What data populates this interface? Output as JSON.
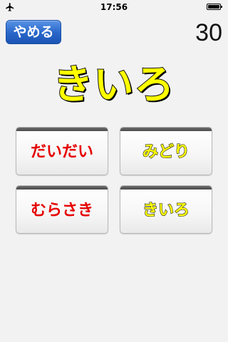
{
  "status_bar": {
    "time": "17:56",
    "airplane_mode_icon": "airplane-icon",
    "battery_icon": "battery-icon",
    "battery_level": 1.0
  },
  "header": {
    "quit_label": "やめる",
    "score": "30"
  },
  "question": {
    "word": "きいろ",
    "word_color": "#ffff00"
  },
  "answers": [
    {
      "label": "だいだい",
      "color": "#e60000"
    },
    {
      "label": "みどり",
      "color": "#ffff00"
    },
    {
      "label": "むらさき",
      "color": "#e60000"
    },
    {
      "label": "きいろ",
      "color": "#ffff00"
    }
  ],
  "colors": {
    "background": "#f2f2f2",
    "quit_button": "#2766c9"
  }
}
